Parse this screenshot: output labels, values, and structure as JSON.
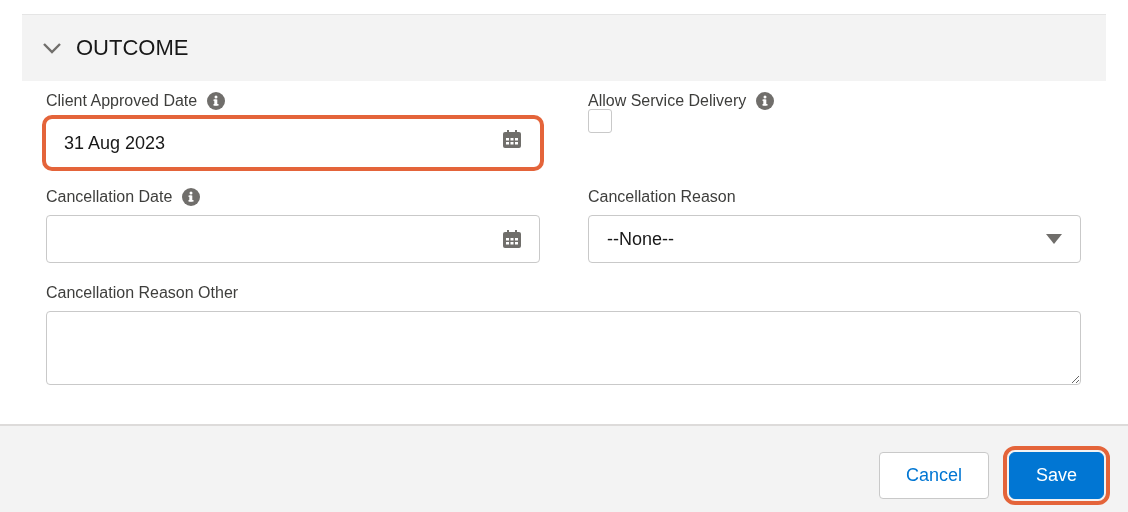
{
  "section": {
    "title": "OUTCOME",
    "expanded": true
  },
  "fields": [
    {
      "kind": "date",
      "label": "Client Approved Date",
      "info": true,
      "value": "31 Aug 2023",
      "highlighted": true
    },
    {
      "kind": "checkbox",
      "label": "Allow Service Delivery",
      "info": true,
      "checked": false
    },
    {
      "kind": "date",
      "label": "Cancellation Date",
      "info": true,
      "highlighted": false
    },
    {
      "kind": "select",
      "label": "Cancellation Reason",
      "info": false,
      "value": "--None--"
    },
    {
      "kind": "textarea",
      "label": "Cancellation Reason Other",
      "info": false
    }
  ],
  "buttons": [
    {
      "label": "Cancel",
      "kind": "neutral",
      "highlighted": false
    },
    {
      "label": "Save",
      "kind": "brand",
      "highlighted": true
    }
  ]
}
